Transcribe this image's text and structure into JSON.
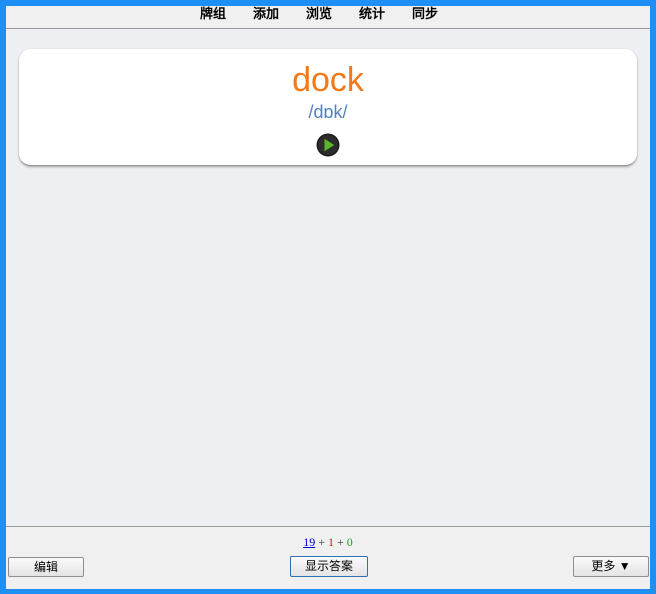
{
  "nav": {
    "items": [
      "牌组",
      "添加",
      "浏览",
      "统计",
      "同步"
    ]
  },
  "card": {
    "word": "dock",
    "phonetic": "/dɒk/",
    "play_icon": "play-circle-icon"
  },
  "counts": {
    "new": "19",
    "plus1": "+",
    "learn": "1",
    "plus2": "+",
    "review": "0"
  },
  "buttons": {
    "edit": "编辑",
    "show_answer": "显示答案",
    "more": "更多 ▼"
  },
  "colors": {
    "frame": "#1E90F5",
    "word": "#F07A1A",
    "phonetic": "#4F82C3",
    "play": "#5AB52A"
  }
}
